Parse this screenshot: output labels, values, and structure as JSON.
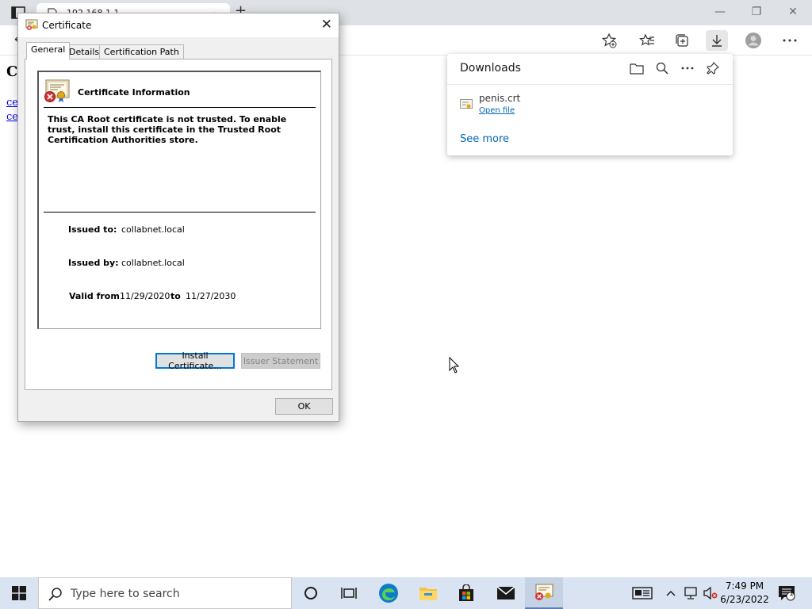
{
  "browser": {
    "tab_title": "192.168.1.1",
    "tab_close": "⌄",
    "new_tab": "+",
    "back": "←",
    "page_heading": "C",
    "page_links": [
      "ce",
      "ce"
    ]
  },
  "downloads": {
    "title": "Downloads",
    "items": [
      {
        "filename": "penis.crt",
        "action": "Open file"
      }
    ],
    "see_more": "See more"
  },
  "dialog": {
    "title": "Certificate",
    "close": "✕",
    "tabs": [
      "General",
      "Details",
      "Certification Path"
    ],
    "selected_tab": "General",
    "info_heading": "Certificate Information",
    "message": "This CA Root certificate is not trusted. To enable trust, install this certificate in the Trusted Root Certification Authorities store.",
    "issued_to_label": "Issued to:",
    "issued_to": "collabnet.local",
    "issued_by_label": "Issued by:",
    "issued_by": "collabnet.local",
    "valid_from_label": "Valid from",
    "valid_from": "11/29/2020",
    "valid_to_label": "to",
    "valid_to": "11/27/2030",
    "install_button": "Install Certificate...",
    "issuer_button": "Issuer Statement",
    "ok_button": "OK"
  },
  "taskbar": {
    "search_placeholder": "Type here to search",
    "time": "7:49 PM",
    "date": "6/23/2022",
    "notification_count": "1"
  },
  "colors": {
    "accent": "#0078d7",
    "link": "#0067b8",
    "taskbar": "#d9e3f1"
  }
}
